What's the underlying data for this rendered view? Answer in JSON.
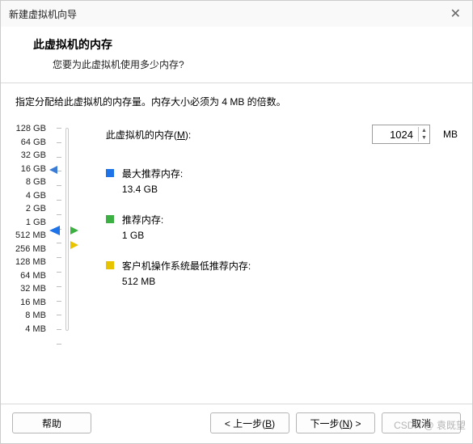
{
  "window": {
    "title": "新建虚拟机向导",
    "close_glyph": "✕"
  },
  "header": {
    "title": "此虚拟机的内存",
    "subtitle": "您要为此虚拟机使用多少内存?"
  },
  "instruction": "指定分配给此虚拟机的内存量。内存大小必须为 4 MB 的倍数。",
  "memory": {
    "label_prefix": "此虚拟机的内存(",
    "label_hotkey": "M",
    "label_suffix": "):",
    "value": "1024",
    "unit": "MB"
  },
  "scale_labels": [
    "128 GB",
    "64 GB",
    "32 GB",
    "16 GB",
    "8 GB",
    "4 GB",
    "2 GB",
    "1 GB",
    "512 MB",
    "256 MB",
    "128 MB",
    "64 MB",
    "32 MB",
    "16 MB",
    "8 MB",
    "4 MB"
  ],
  "legend": {
    "max": {
      "label": "最大推荐内存:",
      "value": "13.4 GB"
    },
    "rec": {
      "label": "推荐内存:",
      "value": "1 GB"
    },
    "min": {
      "label": "客户机操作系统最低推荐内存:",
      "value": "512 MB"
    }
  },
  "buttons": {
    "help": "帮助",
    "back_prefix": "< 上一步(",
    "back_hotkey": "B",
    "back_suffix": ")",
    "next_prefix": "下一步(",
    "next_hotkey": "N",
    "next_suffix": ") >",
    "cancel": "取消"
  },
  "watermark": "CSDN @ 袁既望"
}
